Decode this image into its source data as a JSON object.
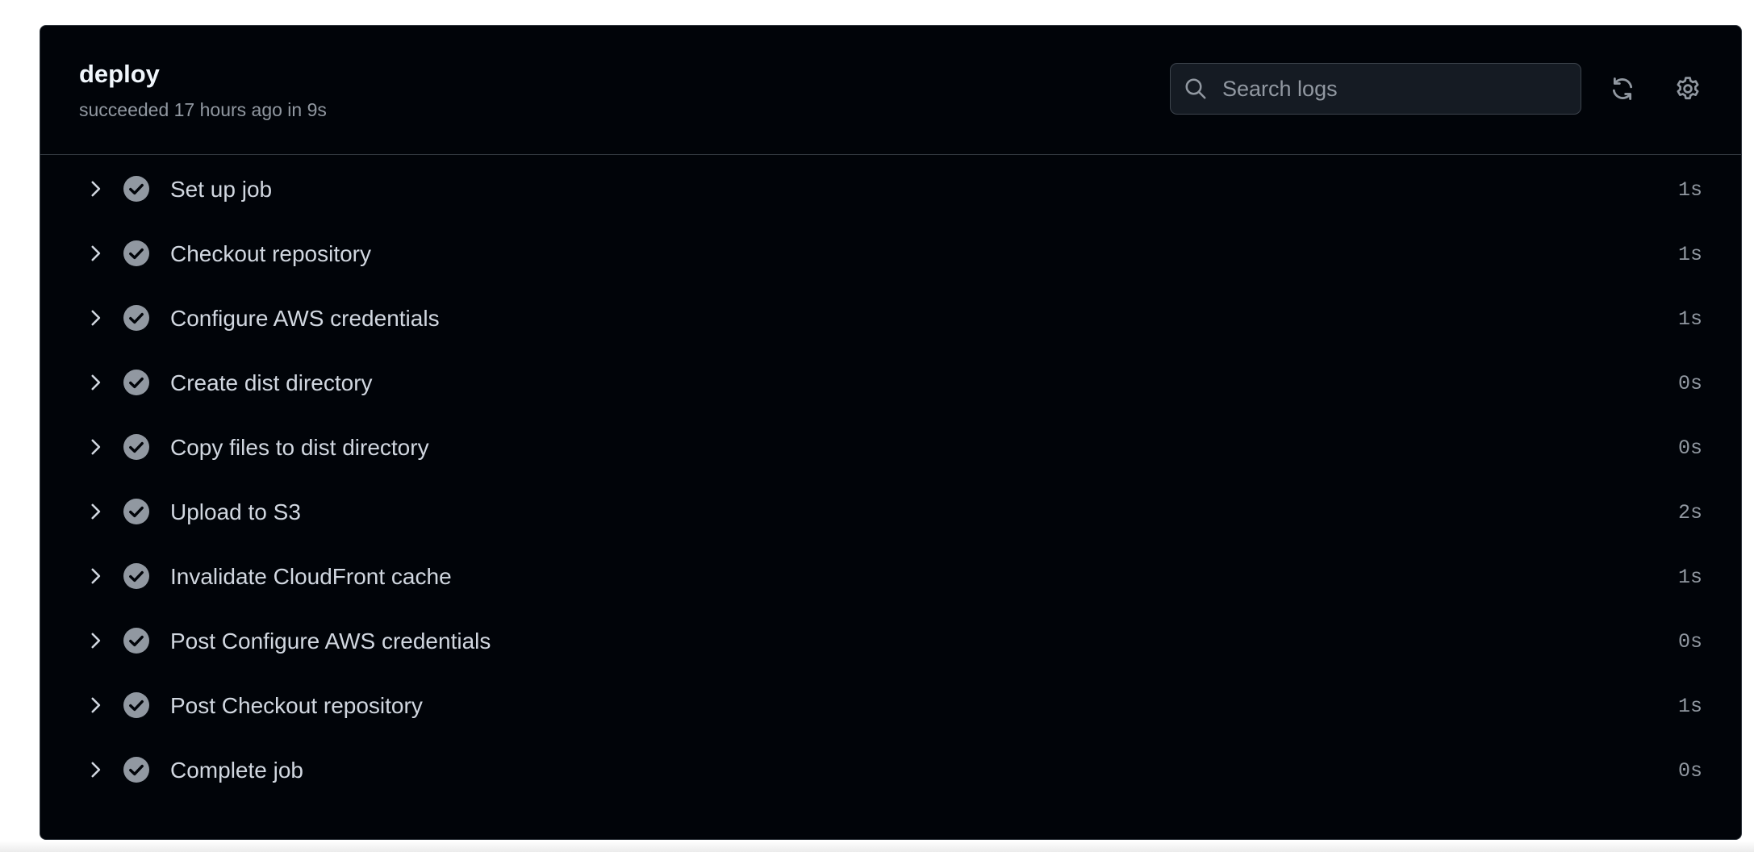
{
  "job": {
    "title": "deploy",
    "subtitle": "succeeded 17 hours ago in 9s"
  },
  "search": {
    "placeholder": "Search logs",
    "value": ""
  },
  "toolbar": {
    "refresh_icon": "sync-icon",
    "settings_icon": "gear-icon"
  },
  "steps": [
    {
      "name": "Set up job",
      "duration": "1s",
      "status": "success"
    },
    {
      "name": "Checkout repository",
      "duration": "1s",
      "status": "success"
    },
    {
      "name": "Configure AWS credentials",
      "duration": "1s",
      "status": "success"
    },
    {
      "name": "Create dist directory",
      "duration": "0s",
      "status": "success"
    },
    {
      "name": "Copy files to dist directory",
      "duration": "0s",
      "status": "success"
    },
    {
      "name": "Upload to S3",
      "duration": "2s",
      "status": "success"
    },
    {
      "name": "Invalidate CloudFront cache",
      "duration": "1s",
      "status": "success"
    },
    {
      "name": "Post Configure AWS credentials",
      "duration": "0s",
      "status": "success"
    },
    {
      "name": "Post Checkout repository",
      "duration": "1s",
      "status": "success"
    },
    {
      "name": "Complete job",
      "duration": "0s",
      "status": "success"
    }
  ],
  "colors": {
    "background": "#010409",
    "border": "#30363d",
    "text_primary": "#f0f6fc",
    "text_secondary": "#9198a1",
    "step_text": "#d1d7e0",
    "check_fill": "#9198a1"
  }
}
